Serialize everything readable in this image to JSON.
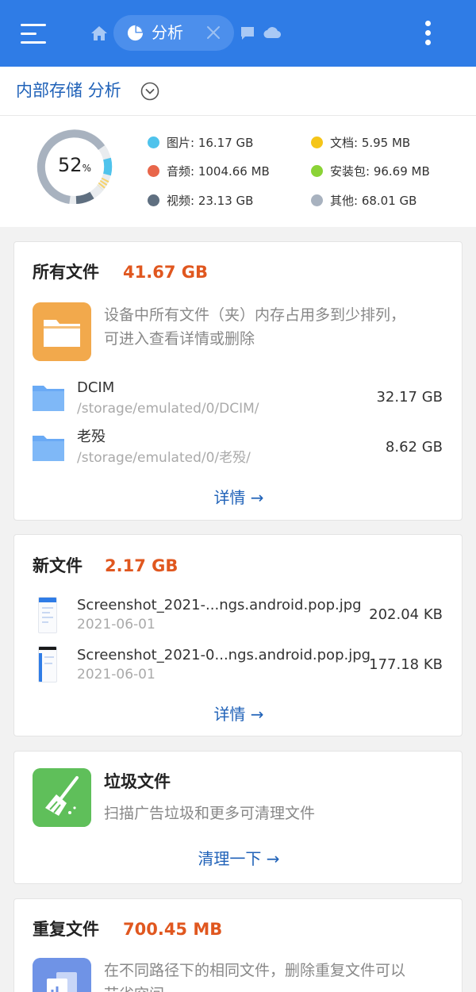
{
  "topbar": {
    "tab_label": "分析"
  },
  "storage": {
    "title": "内部存储 分析"
  },
  "analysis": {
    "percent": "52",
    "percent_unit": "%",
    "legend": [
      {
        "label": "图片: 16.17 GB",
        "color": "#4fc3ec"
      },
      {
        "label": "文档: 5.95 MB",
        "color": "#f5c518"
      },
      {
        "label": "音频: 1004.66 MB",
        "color": "#e8664a"
      },
      {
        "label": "安装包: 96.69 MB",
        "color": "#8bd336"
      },
      {
        "label": "视频: 23.13 GB",
        "color": "#5f6f80"
      },
      {
        "label": "其他: 68.01 GB",
        "color": "#a8b2bf"
      }
    ]
  },
  "all_files": {
    "title": "所有文件",
    "size": "41.67 GB",
    "desc_line1": "设备中所有文件（夹）内存占用多到少排列，",
    "desc_line2": "可进入查看详情或删除",
    "rows": [
      {
        "name": "DCIM",
        "path": "/storage/emulated/0/DCIM/",
        "size": "32.17 GB"
      },
      {
        "name": "老殁",
        "path": "/storage/emulated/0/老殁/",
        "size": "8.62 GB"
      }
    ],
    "link": "详情 →"
  },
  "new_files": {
    "title": "新文件",
    "size": "2.17 GB",
    "rows": [
      {
        "name": "Screenshot_2021-...ngs.android.pop.jpg",
        "date": "2021-06-01",
        "size": "202.04 KB"
      },
      {
        "name": "Screenshot_2021-0...ngs.android.pop.jpg",
        "date": "2021-06-01",
        "size": "177.18 KB"
      }
    ],
    "link": "详情 →"
  },
  "junk": {
    "title": "垃圾文件",
    "desc": "扫描广告垃圾和更多可清理文件",
    "link": "清理一下 →"
  },
  "duplicates": {
    "title": "重复文件",
    "size": "700.45 MB",
    "desc_line1": "在不同路径下的相同文件，删除重复文件可以",
    "desc_line2": "节省空间"
  },
  "colors": {
    "brand": "#2f7ce6",
    "link": "#2062b8",
    "size_accent": "#e0571f"
  }
}
